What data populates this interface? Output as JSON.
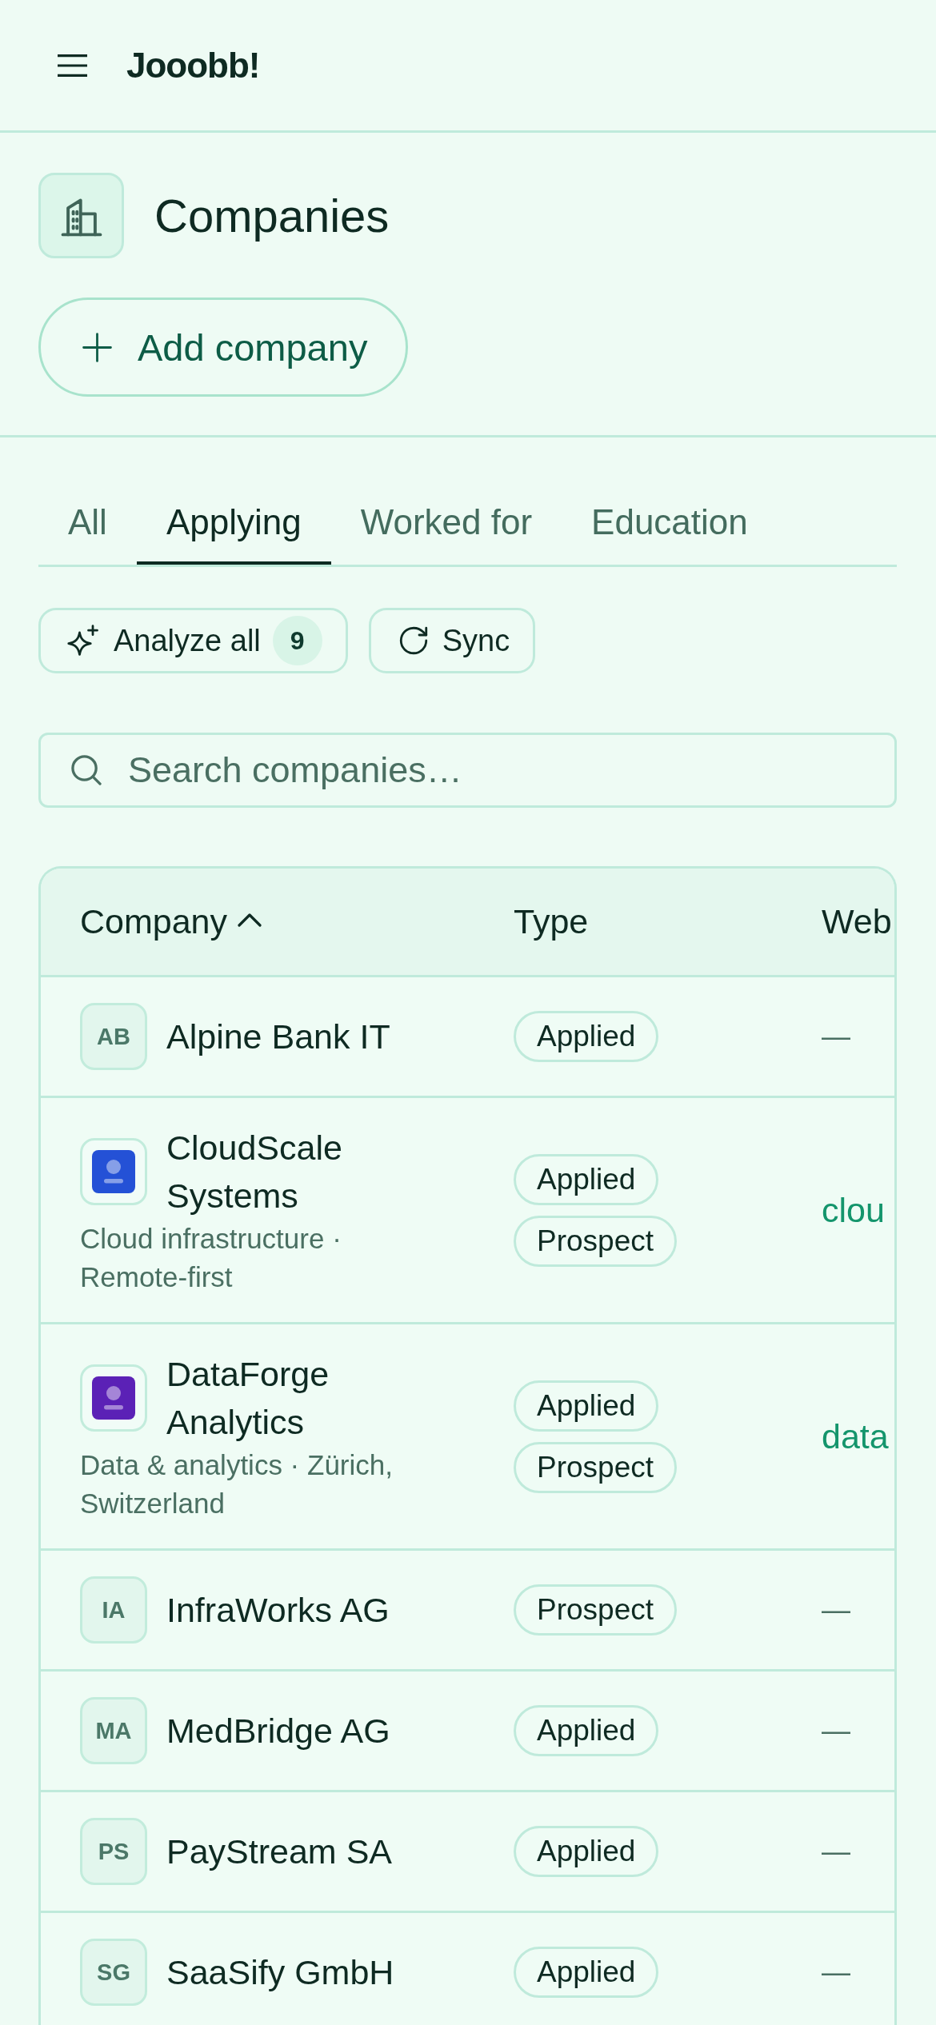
{
  "app_bar": {
    "title": "Jooobb!"
  },
  "page_header": {
    "title": "Companies",
    "add_button": "Add company"
  },
  "tabs": [
    {
      "label": "All",
      "selected": false
    },
    {
      "label": "Applying",
      "selected": true
    },
    {
      "label": "Worked for",
      "selected": false
    },
    {
      "label": "Education",
      "selected": false
    }
  ],
  "actions": [
    {
      "kind": "analyze",
      "label": "Analyze all",
      "count": "9"
    },
    {
      "kind": "sync",
      "label": "Sync"
    }
  ],
  "search": {
    "placeholder": "Search companies…"
  },
  "table": {
    "columns": [
      {
        "label": "Company",
        "sorted": true,
        "ascending": true
      },
      {
        "label": "Type"
      },
      {
        "label": "Web"
      }
    ],
    "rows": [
      {
        "name": "Alpine Bank IT",
        "avatar": {
          "kind": "initials",
          "text": "AB"
        },
        "types": [
          "Applied"
        ],
        "website": {
          "kind": "none",
          "text": "—"
        }
      },
      {
        "name": "CloudScale Systems",
        "avatar": {
          "kind": "logo",
          "color": "#2451d6"
        },
        "description": "Cloud infrastructure · Remote-first",
        "types": [
          "Applied",
          "Prospect"
        ],
        "website": {
          "kind": "link",
          "text": "clou"
        }
      },
      {
        "name": "DataForge Analytics",
        "avatar": {
          "kind": "logo",
          "color": "#5b21b6"
        },
        "description": "Data & analytics · Zürich, Switzerland",
        "types": [
          "Applied",
          "Prospect"
        ],
        "website": {
          "kind": "link",
          "text": "data"
        }
      },
      {
        "name": "InfraWorks AG",
        "avatar": {
          "kind": "initials",
          "text": "IA"
        },
        "types": [
          "Prospect"
        ],
        "website": {
          "kind": "none",
          "text": "—"
        }
      },
      {
        "name": "MedBridge AG",
        "avatar": {
          "kind": "initials",
          "text": "MA"
        },
        "types": [
          "Applied"
        ],
        "website": {
          "kind": "none",
          "text": "—"
        }
      },
      {
        "name": "PayStream SA",
        "avatar": {
          "kind": "initials",
          "text": "PS"
        },
        "types": [
          "Applied"
        ],
        "website": {
          "kind": "none",
          "text": "—"
        }
      },
      {
        "name": "SaaSify GmbH",
        "avatar": {
          "kind": "initials",
          "text": "SG"
        },
        "types": [
          "Applied"
        ],
        "website": {
          "kind": "none",
          "text": "—"
        }
      }
    ]
  }
}
